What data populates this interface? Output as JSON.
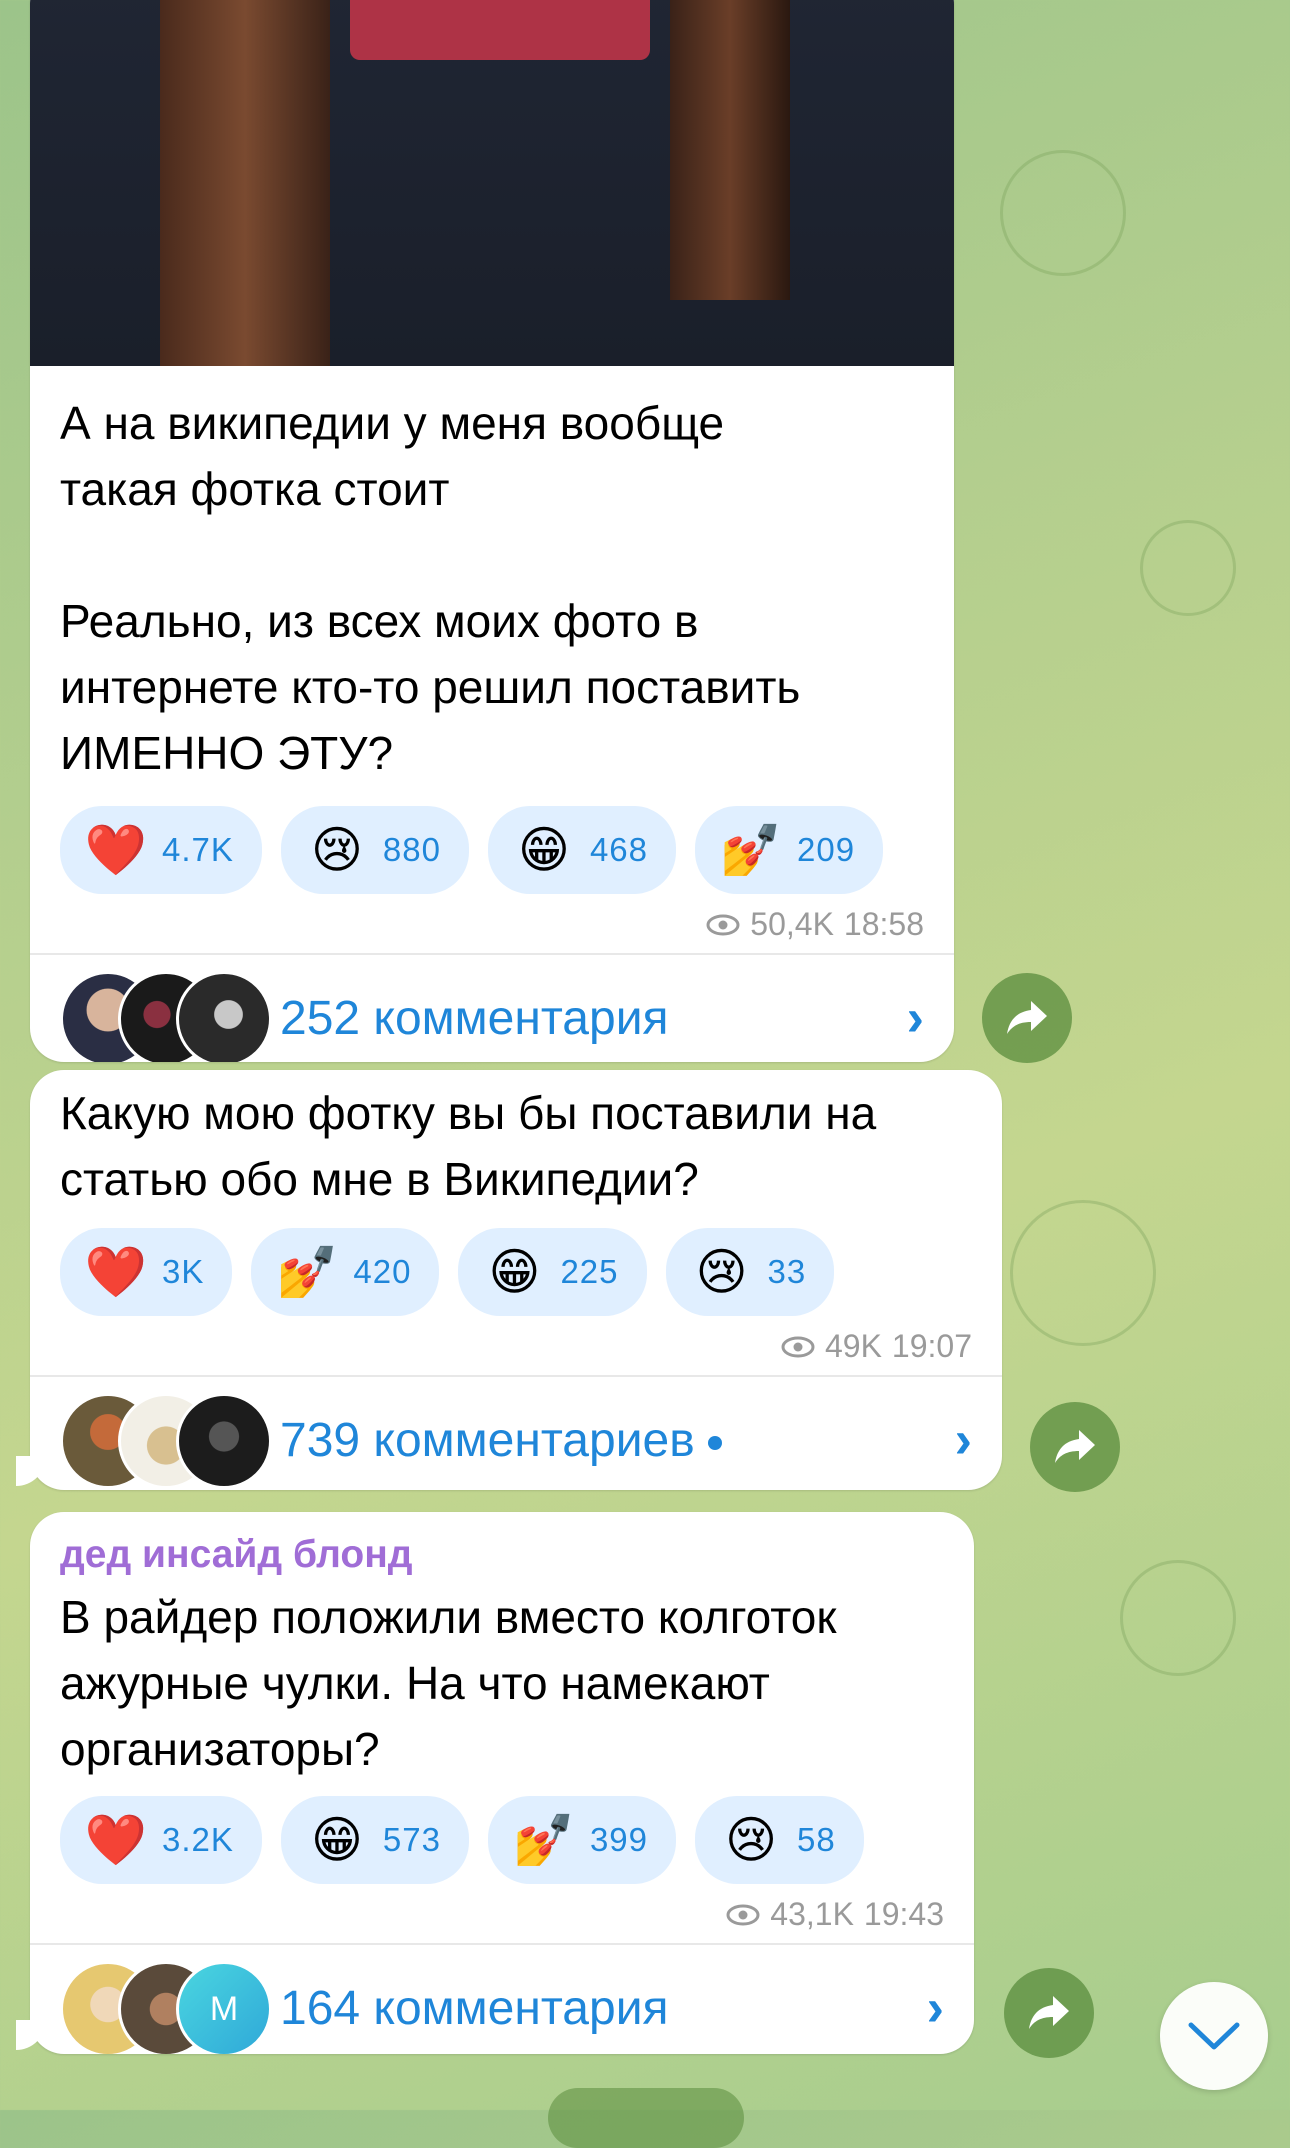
{
  "messages": [
    {
      "text": "А на википедии у меня вообще\nтакая фотка стоит\n\nРеально, из всех моих фото в\nинтернете кто-то решил поставить\nИМЕННО ЭТУ?",
      "reactions": [
        {
          "emoji": "❤️",
          "icon": "heart-icon",
          "count": "4.7K"
        },
        {
          "emoji": "😢",
          "icon": "crying-face-icon",
          "count": "880"
        },
        {
          "emoji": "😁",
          "icon": "grinning-face-icon",
          "count": "468"
        },
        {
          "emoji": "💅",
          "icon": "nail-polish-icon",
          "count": "209"
        }
      ],
      "views": "50,4K",
      "time": "18:58",
      "comments": "252 комментария"
    },
    {
      "text": "Какую мою фотку вы бы поставили на\nстатью обо мне в Википедии?",
      "reactions": [
        {
          "emoji": "❤️",
          "icon": "heart-icon",
          "count": "3K"
        },
        {
          "emoji": "💅",
          "icon": "nail-polish-icon",
          "count": "420"
        },
        {
          "emoji": "😁",
          "icon": "grinning-face-icon",
          "count": "225"
        },
        {
          "emoji": "😢",
          "icon": "crying-face-icon",
          "count": "33"
        }
      ],
      "views": "49K",
      "time": "19:07",
      "comments": "739 комментариев"
    },
    {
      "sender": "дед инсайд блонд",
      "text": "В райдер положили вместо колготок\nажурные чулки. На что намекают\nорганизаторы?",
      "reactions": [
        {
          "emoji": "❤️",
          "icon": "heart-icon",
          "count": "3.2K"
        },
        {
          "emoji": "😁",
          "icon": "grinning-face-icon",
          "count": "573"
        },
        {
          "emoji": "💅",
          "icon": "nail-polish-icon",
          "count": "399"
        },
        {
          "emoji": "😢",
          "icon": "crying-face-icon",
          "count": "58"
        }
      ],
      "views": "43,1K",
      "time": "19:43",
      "comments": "164 комментария",
      "avatar_initial": "M"
    }
  ],
  "colors": {
    "link": "#1f86d9",
    "reaction_bg": "#e0efff",
    "sender": "#a06dd6",
    "bubble": "#ffffff"
  }
}
